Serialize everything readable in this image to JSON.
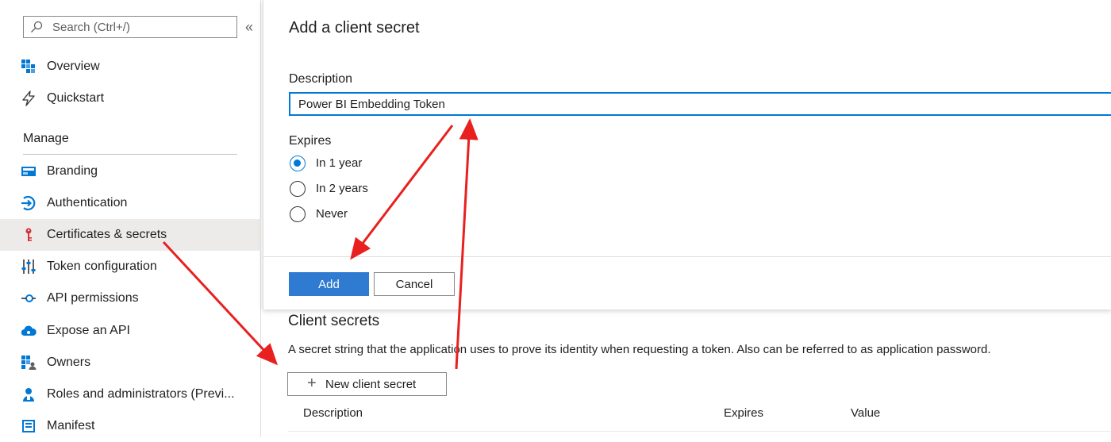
{
  "sidebar": {
    "search_placeholder": "Search (Ctrl+/)",
    "collapse_label": "«",
    "top_items": [
      {
        "label": "Overview",
        "icon": "overview-grid-icon"
      },
      {
        "label": "Quickstart",
        "icon": "lightning-icon"
      }
    ],
    "section_heading": "Manage",
    "manage_items": [
      {
        "label": "Branding",
        "icon": "branding-icon"
      },
      {
        "label": "Authentication",
        "icon": "authentication-icon"
      },
      {
        "label": "Certificates & secrets",
        "icon": "key-icon",
        "selected": true
      },
      {
        "label": "Token configuration",
        "icon": "sliders-icon"
      },
      {
        "label": "API permissions",
        "icon": "api-permissions-icon"
      },
      {
        "label": "Expose an API",
        "icon": "cloud-icon"
      },
      {
        "label": "Owners",
        "icon": "owners-icon"
      },
      {
        "label": "Roles and administrators (Previ...",
        "icon": "roles-icon"
      },
      {
        "label": "Manifest",
        "icon": "manifest-icon"
      }
    ]
  },
  "dialog": {
    "title": "Add a client secret",
    "description_label": "Description",
    "description_value": "Power BI Embedding Token",
    "expires_label": "Expires",
    "expires_options": [
      {
        "label": "In 1 year",
        "checked": true
      },
      {
        "label": "In 2 years",
        "checked": false
      },
      {
        "label": "Never",
        "checked": false
      }
    ],
    "add_label": "Add",
    "cancel_label": "Cancel"
  },
  "client_secrets": {
    "title": "Client secrets",
    "description": "A secret string that the application uses to prove its identity when requesting a token. Also can be referred to as application password.",
    "new_button_label": "New client secret",
    "columns": [
      "Description",
      "Expires",
      "Value"
    ]
  },
  "colors": {
    "accent": "#0078d4",
    "primary_button": "#2f7bd1",
    "annotation_arrow": "#e8201f"
  }
}
